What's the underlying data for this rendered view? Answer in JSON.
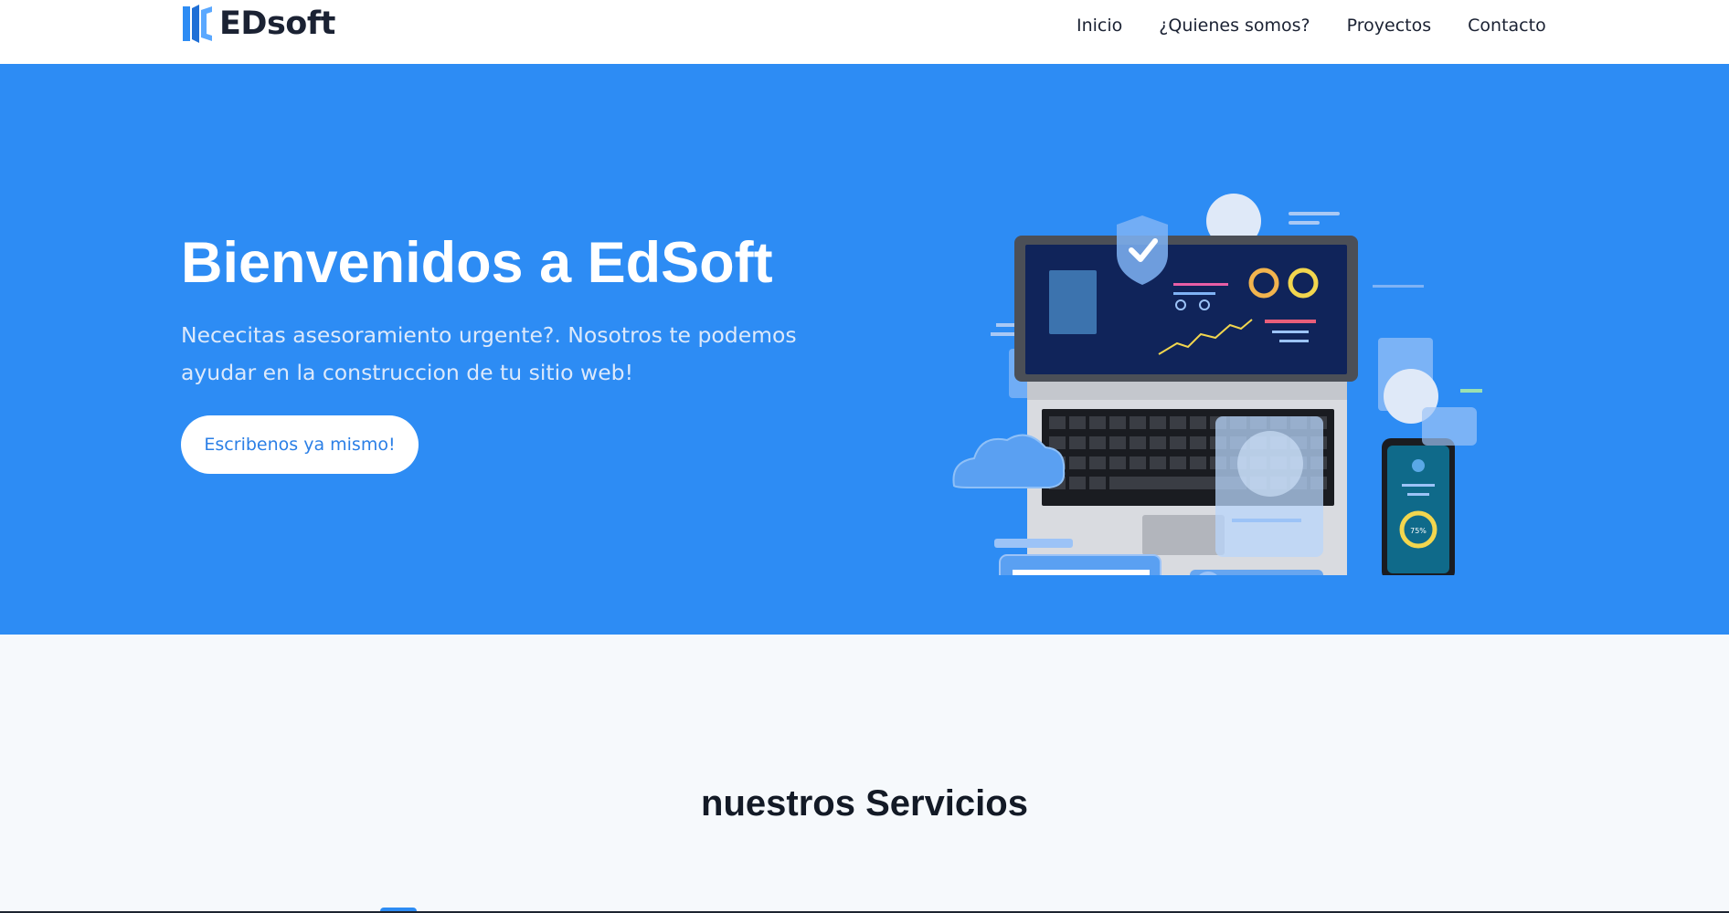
{
  "header": {
    "brand": "EDsoft",
    "nav": [
      "Inicio",
      "¿Quienes somos?",
      "Proyectos",
      "Contacto"
    ]
  },
  "hero": {
    "title": "Bienvenidos a EdSoft",
    "text": "Nececitas asesoramiento urgente?. Nosotros te podemos ayudar en la construccion de tu sitio web!",
    "button": "Escribenos ya mismo!",
    "illustration": {
      "phone_progress": "75%",
      "icons": [
        "laptop-icon",
        "shield-check-icon",
        "cloud-icon",
        "phone-icon",
        "user-icon"
      ]
    }
  },
  "services": {
    "title": "nuestros Servicios"
  },
  "colors": {
    "primary": "#2d8cf4",
    "brand_dark": "#1b2233",
    "button_text": "#2b7fe6",
    "page_bg": "#f6f9fc"
  }
}
